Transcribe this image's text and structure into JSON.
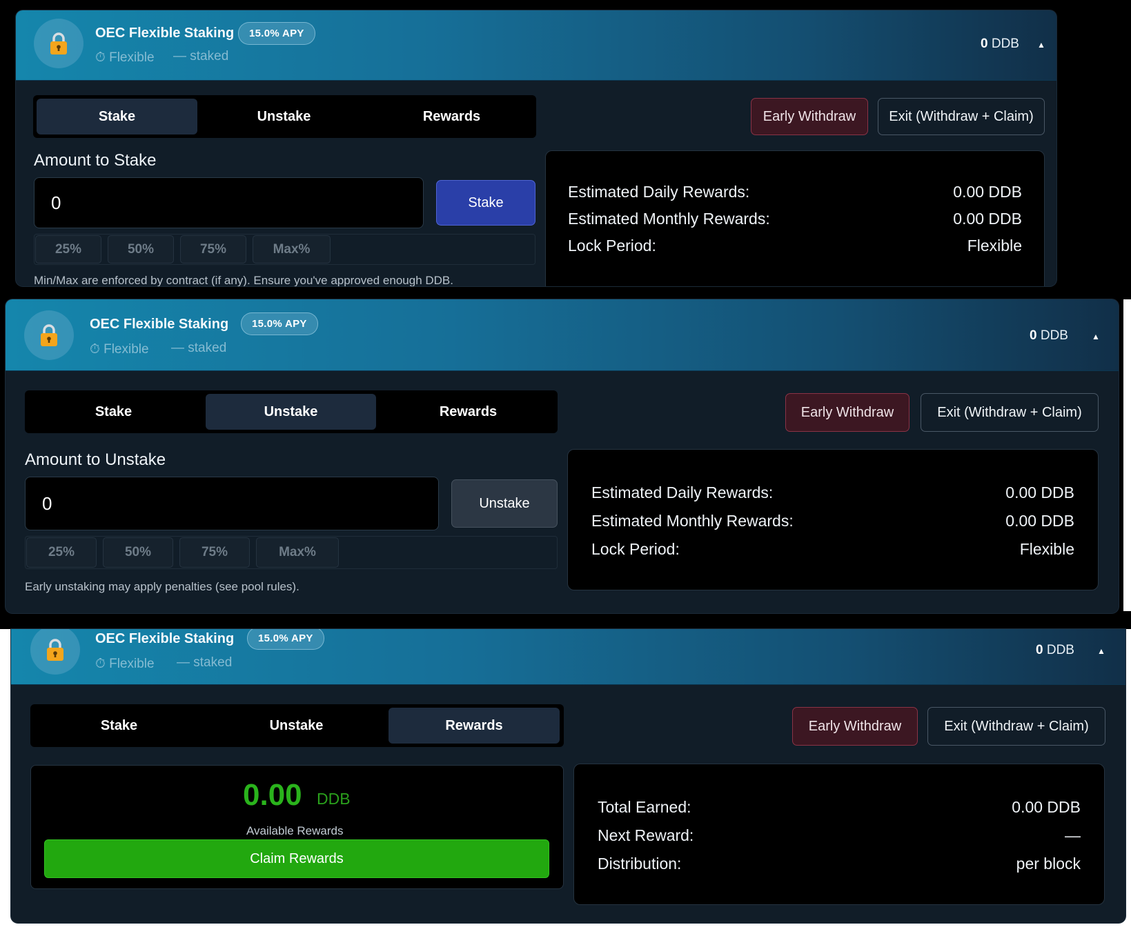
{
  "pool": {
    "title": "OEC Flexible Staking",
    "apy": "15.0% APY",
    "mode": "⏱ Flexible",
    "staked": "— staked",
    "balance_value": "0",
    "balance_unit": "DDB",
    "caret": "▲"
  },
  "tabs": {
    "stake": "Stake",
    "unstake": "Unstake",
    "rewards": "Rewards"
  },
  "actions": {
    "early_withdraw": "Early Withdraw",
    "exit": "Exit (Withdraw + Claim)"
  },
  "stake_panel": {
    "label": "Amount to Stake",
    "value": "0",
    "button": "Stake",
    "hint": "Min/Max are enforced by contract (if any). Ensure you've approved enough DDB."
  },
  "unstake_panel": {
    "label": "Amount to Unstake",
    "value": "0",
    "button": "Unstake",
    "hint": "Early unstaking may apply penalties (see pool rules)."
  },
  "percent_buttons": [
    "25%",
    "50%",
    "75%",
    "Max%"
  ],
  "estimates": {
    "daily_label": "Estimated Daily Rewards:",
    "daily_value": "0.00 DDB",
    "monthly_label": "Estimated Monthly Rewards:",
    "monthly_value": "0.00 DDB",
    "lock_label": "Lock Period:",
    "lock_value": "Flexible"
  },
  "rewards_panel": {
    "amount": "0.00",
    "unit": "DDB",
    "label": "Available Rewards",
    "claim": "Claim Rewards",
    "total_label": "Total Earned:",
    "total_value": "0.00 DDB",
    "next_label": "Next Reward:",
    "next_value": "—",
    "dist_label": "Distribution:",
    "dist_value": "per block"
  },
  "colors": {
    "header_start": "#1586ac",
    "header_end": "#112f48",
    "stake_button": "#2a3fa8",
    "claim_button": "#22a80f",
    "reward_amount": "#2ab31c",
    "early_withdraw": "#3c1722"
  }
}
